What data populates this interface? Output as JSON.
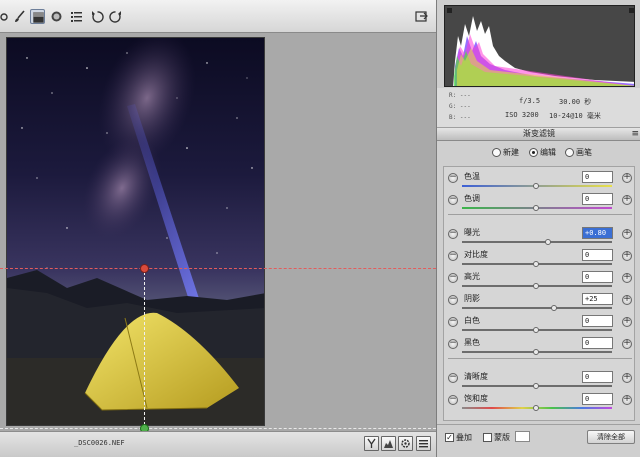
{
  "toolbar": {
    "tools": [
      {
        "name": "hand-tool",
        "active": false
      },
      {
        "name": "brush-tool",
        "active": false
      },
      {
        "name": "graduated-filter-tool",
        "active": true
      },
      {
        "name": "radial-filter-tool",
        "active": false
      },
      {
        "name": "presets-list-tool",
        "active": false
      },
      {
        "name": "rotate-left-tool",
        "active": false
      },
      {
        "name": "rotate-right-tool",
        "active": false
      }
    ],
    "export_icon": "export-icon"
  },
  "canvas": {
    "guide_color": "#e04646",
    "guide_line_color": "#f3f3f3"
  },
  "statusbar": {
    "filename": "_DSC0026.NEF",
    "buttons": [
      "y-icon",
      "histogram-tool-icon",
      "gear-icon",
      "list-icon"
    ]
  },
  "info": {
    "r_label": "R:",
    "g_label": "G:",
    "b_label": "B:",
    "rgb_value": "---",
    "aperture": "f/3.5",
    "shutter": "30.00 秒",
    "iso": "ISO 3200",
    "lens": "10-24@10 毫米"
  },
  "panel": {
    "title": "渐变滤镜",
    "menu_icon": "≡",
    "modes": {
      "new_label": "新建",
      "edit_label": "编辑",
      "brush_label": "画笔",
      "selected": "edit"
    },
    "sliders": [
      {
        "id": "temp",
        "label": "色温",
        "value": "0",
        "pos": 0.5,
        "track": "temp",
        "selected": false
      },
      {
        "id": "tint",
        "label": "色调",
        "value": "0",
        "pos": 0.5,
        "track": "tint",
        "selected": false
      },
      {
        "id": "exposure",
        "label": "曝光",
        "value": "+0.80",
        "pos": 0.58,
        "track": "gray",
        "selected": true
      },
      {
        "id": "contrast",
        "label": "对比度",
        "value": "0",
        "pos": 0.5,
        "track": "gray",
        "selected": false
      },
      {
        "id": "highlights",
        "label": "高光",
        "value": "0",
        "pos": 0.5,
        "track": "gray",
        "selected": false
      },
      {
        "id": "shadows",
        "label": "阴影",
        "value": "+25",
        "pos": 0.62,
        "track": "gray",
        "selected": false
      },
      {
        "id": "whites",
        "label": "白色",
        "value": "0",
        "pos": 0.5,
        "track": "gray",
        "selected": false
      },
      {
        "id": "blacks",
        "label": "黑色",
        "value": "0",
        "pos": 0.5,
        "track": "gray",
        "selected": false
      },
      {
        "id": "clarity",
        "label": "清晰度",
        "value": "0",
        "pos": 0.5,
        "track": "gray",
        "selected": false
      },
      {
        "id": "saturation",
        "label": "饱和度",
        "value": "0",
        "pos": 0.5,
        "track": "sat",
        "selected": false
      }
    ],
    "overlay_label": "叠加",
    "overlay_checked": true,
    "mask_label": "蒙版",
    "mask_checked": false,
    "clear_all_label": "清除全部"
  }
}
